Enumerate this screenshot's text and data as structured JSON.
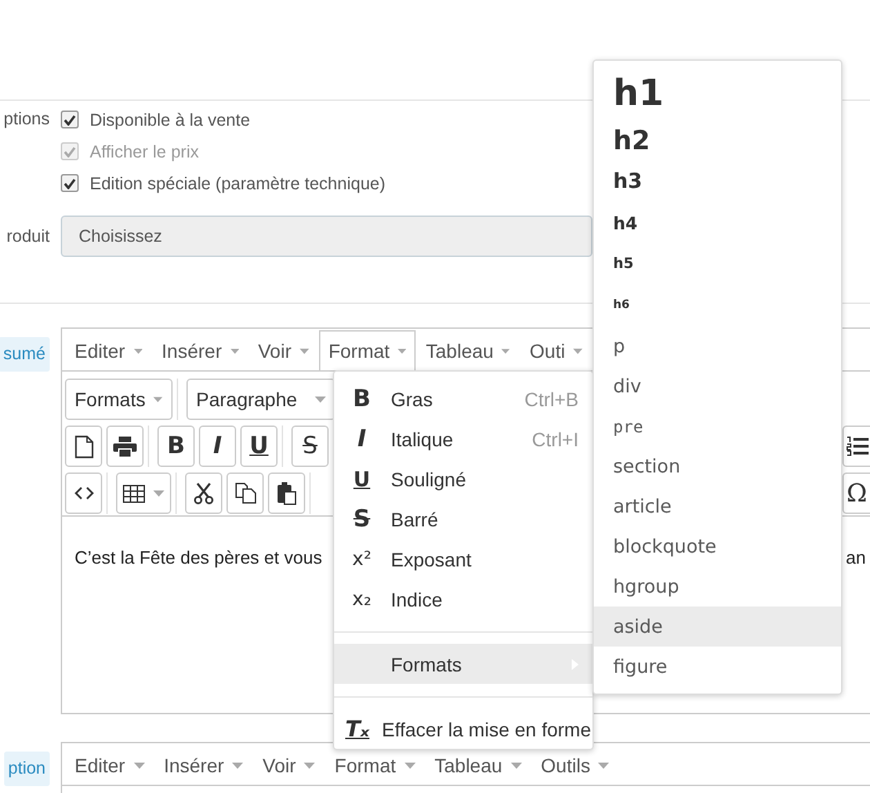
{
  "options_field": {
    "label": "ptions",
    "checkboxes": [
      {
        "label": "Disponible à la vente",
        "checked": true,
        "disabled": false
      },
      {
        "label": "Afficher le prix",
        "checked": true,
        "disabled": true
      },
      {
        "label": "Edition spéciale (paramètre technique)",
        "checked": true,
        "disabled": false
      }
    ]
  },
  "product_field": {
    "label": "roduit",
    "select": {
      "value": "Choisissez"
    }
  },
  "editors": [
    {
      "label": "sumé",
      "menubar": [
        {
          "label": "Editer",
          "selected": false
        },
        {
          "label": "Insérer",
          "selected": false
        },
        {
          "label": "Voir",
          "selected": false
        },
        {
          "label": "Format",
          "selected": true
        },
        {
          "label": "Tableau",
          "selected": false
        },
        {
          "label": "Outi",
          "selected": false
        }
      ],
      "toolbar": [
        {
          "groups": [
            [
              {
                "kind": "dropdown",
                "text": "Formats"
              }
            ],
            [
              {
                "kind": "dropdown",
                "text": "Paragraphe"
              }
            ]
          ]
        },
        {
          "groups": [
            [
              {
                "kind": "new-document"
              },
              {
                "kind": "print"
              }
            ],
            [
              {
                "kind": "bold",
                "text": "B"
              },
              {
                "kind": "italic",
                "text": "I"
              },
              {
                "kind": "underline",
                "text": "U"
              }
            ],
            [
              {
                "kind": "strike",
                "text": "S"
              }
            ]
          ],
          "right": [
            {
              "kind": "ordered-list"
            }
          ]
        },
        {
          "groups": [
            [
              {
                "kind": "code"
              }
            ],
            [
              {
                "kind": "table"
              }
            ],
            [
              {
                "kind": "cut"
              },
              {
                "kind": "copy"
              },
              {
                "kind": "paste"
              }
            ]
          ],
          "right": [
            {
              "kind": "symbol",
              "text": "Ω"
            }
          ]
        }
      ],
      "content": [
        "C’est la Fête des pères et vous",
        "an"
      ]
    },
    {
      "label": "ption",
      "menubar": [
        {
          "label": "Editer",
          "selected": false
        },
        {
          "label": "Insérer",
          "selected": false
        },
        {
          "label": "Voir",
          "selected": false
        },
        {
          "label": "Format",
          "selected": false
        },
        {
          "label": "Tableau",
          "selected": false
        },
        {
          "label": "Outils",
          "selected": false
        }
      ]
    }
  ],
  "format_menu": {
    "items": [
      {
        "kind": "bold",
        "icon_text": "B",
        "label": "Gras",
        "shortcut": "Ctrl+B"
      },
      {
        "kind": "italic",
        "icon_text": "I",
        "label": "Italique",
        "shortcut": "Ctrl+I"
      },
      {
        "kind": "underline",
        "icon_text": "U",
        "label": "Souligné"
      },
      {
        "kind": "strike",
        "icon_text": "S",
        "label": "Barré"
      },
      {
        "kind": "superscript",
        "icon_text": "x²",
        "label": "Exposant"
      },
      {
        "kind": "subscript",
        "icon_text": "x₂",
        "label": "Indice"
      },
      {
        "kind": "separator"
      },
      {
        "kind": "submenu",
        "label": "Formats",
        "selected": true
      },
      {
        "kind": "separator"
      },
      {
        "kind": "clear",
        "icon_text": "Tₓ",
        "label": "Effacer la mise en forme"
      }
    ]
  },
  "formats_submenu": {
    "items": [
      {
        "kind": "h1",
        "label": "h1",
        "selected": false
      },
      {
        "kind": "h2",
        "label": "h2",
        "selected": false
      },
      {
        "kind": "h3",
        "label": "h3",
        "selected": false
      },
      {
        "kind": "h4",
        "label": "h4",
        "selected": false
      },
      {
        "kind": "h5",
        "label": "h5",
        "selected": false
      },
      {
        "kind": "h6",
        "label": "h6",
        "selected": false
      },
      {
        "kind": "block",
        "label": "p",
        "selected": false
      },
      {
        "kind": "block",
        "label": "div",
        "selected": false
      },
      {
        "kind": "pre",
        "label": "pre",
        "selected": false
      },
      {
        "kind": "block",
        "label": "section",
        "selected": false
      },
      {
        "kind": "block",
        "label": "article",
        "selected": false
      },
      {
        "kind": "block",
        "label": "blockquote",
        "selected": false
      },
      {
        "kind": "block",
        "label": "hgroup",
        "selected": false
      },
      {
        "kind": "block",
        "label": "aside",
        "selected": true
      },
      {
        "kind": "block",
        "label": "figure",
        "selected": false
      }
    ]
  }
}
